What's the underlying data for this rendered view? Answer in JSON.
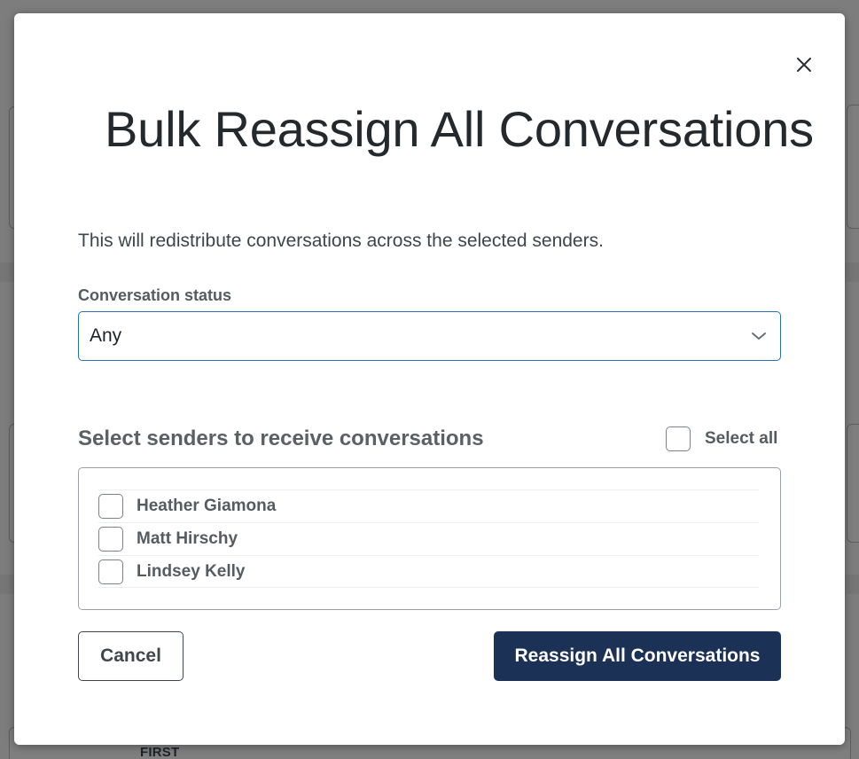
{
  "modal": {
    "title": "Bulk Reassign All Conversations",
    "description": "This will redistribute conversations across the selected senders.",
    "status_label": "Conversation status",
    "status_value": "Any",
    "senders_heading": "Select senders to receive conversations",
    "select_all_label": "Select all",
    "senders": [
      {
        "name": "Heather Giamona"
      },
      {
        "name": "Matt Hirschy"
      },
      {
        "name": "Lindsey Kelly"
      }
    ],
    "cancel_label": "Cancel",
    "submit_label": "Reassign All Conversations"
  },
  "background": {
    "table_header": "FIRST"
  },
  "icons": {
    "close": "close-icon",
    "dropdown": "chevron-down-icon"
  },
  "colors": {
    "primary_button": "#1c3156",
    "select_border": "#2c6fb7",
    "overlay": "#7b7b7b"
  }
}
